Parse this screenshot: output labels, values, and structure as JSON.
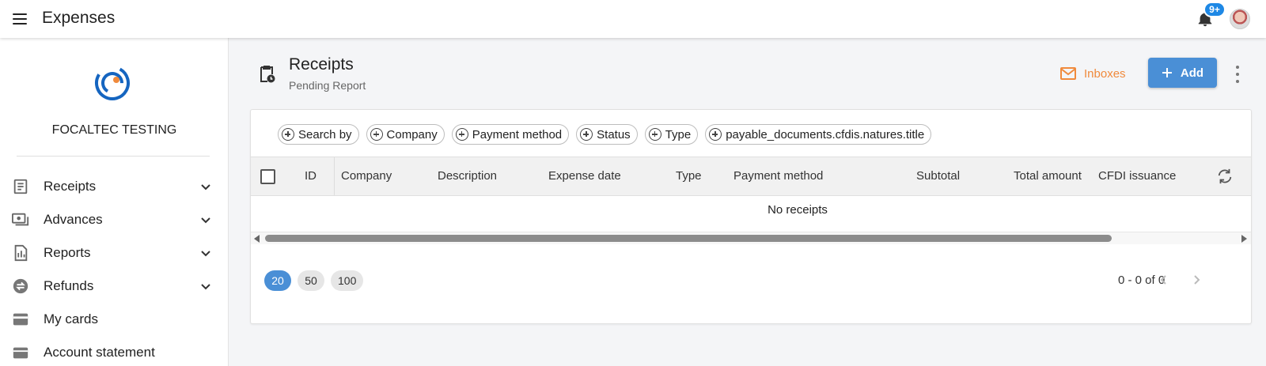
{
  "app": {
    "title": "Expenses",
    "notifications_badge": "9+"
  },
  "sidebar": {
    "company_name": "FOCALTEC TESTING",
    "items": [
      {
        "label": "Receipts",
        "icon": "receipt-icon",
        "expandable": true
      },
      {
        "label": "Advances",
        "icon": "money-icon",
        "expandable": true
      },
      {
        "label": "Reports",
        "icon": "report-icon",
        "expandable": true
      },
      {
        "label": "Refunds",
        "icon": "refund-icon",
        "expandable": true
      },
      {
        "label": "My cards",
        "icon": "card-icon",
        "expandable": false
      },
      {
        "label": "Account statement",
        "icon": "wallet-icon",
        "expandable": false
      }
    ]
  },
  "page": {
    "title": "Receipts",
    "subtitle": "Pending Report",
    "inboxes_label": "Inboxes",
    "add_label": "Add"
  },
  "filters": [
    "Search by",
    "Company",
    "Payment method",
    "Status",
    "Type",
    "payable_documents.cfdis.natures.title"
  ],
  "table": {
    "columns": [
      "ID",
      "Company",
      "Description",
      "Expense date",
      "Type",
      "Payment method",
      "Subtotal",
      "Total amount",
      "CFDI issuance"
    ],
    "empty_message": "No receipts",
    "scroll_fraction": 0.87
  },
  "pagination": {
    "page_sizes": [
      "20",
      "50",
      "100"
    ],
    "selected_size": "20",
    "range": "0 - 0 of 0"
  },
  "colors": {
    "accent": "#4a8fd6",
    "inbox": "#f08a3c",
    "badge": "#1e88e5",
    "logo_blue": "#1565c0",
    "logo_orange": "#f08a3c"
  }
}
